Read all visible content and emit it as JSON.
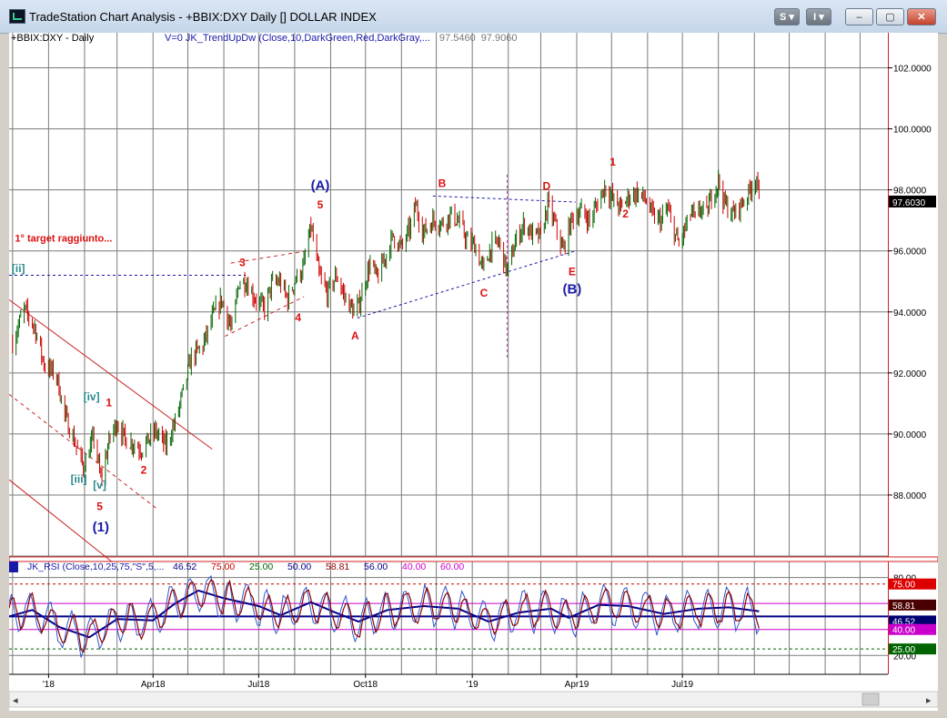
{
  "window": {
    "title": "TradeStation Chart Analysis - +BBIX:DXY Daily [] DOLLAR INDEX",
    "buttons": {
      "s": "S ▾",
      "i": "I ▾",
      "minimize": "‒",
      "maximize": "▢",
      "close": "✕"
    }
  },
  "colors": {
    "bull": "#006400",
    "bear": "#cc0000",
    "wave_red": "#dd1111",
    "wave_blue": "#1a1aaa",
    "wave_teal": "#2a8a8a",
    "rsi_fast": "#8b0000",
    "rsi_slow": "#00008b"
  },
  "chart_data": [
    {
      "type": "candlestick",
      "symbol_label": "+BBIX:DXY - Daily",
      "indicator_label": "V=0  JK_TrendUpDw  (Close,10,DarkGreen,Red,DarkGray,...",
      "indicator_values": [
        "97.5460",
        "97.9060"
      ],
      "last_price": "97.6030",
      "ylim": [
        86,
        103
      ],
      "y_ticks": [
        "88.0000",
        "90.0000",
        "92.0000",
        "94.0000",
        "96.0000",
        "98.0000",
        "100.0000",
        "102.0000"
      ],
      "x_ticks": [
        "'18",
        "Apr18",
        "Jul18",
        "Oct18",
        "'19",
        "Apr19",
        "Jul19"
      ],
      "x_tick_dates": [
        "2018-01-01",
        "2018-04-01",
        "2018-07-01",
        "2018-10-01",
        "2019-01-01",
        "2019-04-01",
        "2019-07-01"
      ],
      "x_range": [
        "2017-11-28",
        "2019-12-25"
      ],
      "grid": true,
      "price_path": [
        [
          "2017-12-01",
          93.0
        ],
        [
          "2017-12-11",
          94.1
        ],
        [
          "2017-12-20",
          93.5
        ],
        [
          "2017-12-28",
          92.3
        ],
        [
          "2018-01-08",
          91.9
        ],
        [
          "2018-01-15",
          90.6
        ],
        [
          "2018-01-22",
          89.9
        ],
        [
          "2018-01-31",
          88.9
        ],
        [
          "2018-02-09",
          89.9
        ],
        [
          "2018-02-15",
          88.5
        ],
        [
          "2018-02-23",
          89.9
        ],
        [
          "2018-03-01",
          90.4
        ],
        [
          "2018-03-08",
          89.8
        ],
        [
          "2018-03-15",
          89.7
        ],
        [
          "2018-03-22",
          89.5
        ],
        [
          "2018-04-03",
          90.1
        ],
        [
          "2018-04-12",
          89.6
        ],
        [
          "2018-04-20",
          90.4
        ],
        [
          "2018-04-27",
          91.4
        ],
        [
          "2018-05-04",
          92.5
        ],
        [
          "2018-05-14",
          92.9
        ],
        [
          "2018-05-22",
          93.8
        ],
        [
          "2018-05-30",
          94.4
        ],
        [
          "2018-06-08",
          93.4
        ],
        [
          "2018-06-14",
          95.0
        ],
        [
          "2018-06-20",
          95.0
        ],
        [
          "2018-06-27",
          94.5
        ],
        [
          "2018-07-06",
          94.1
        ],
        [
          "2018-07-12",
          94.9
        ],
        [
          "2018-07-19",
          95.0
        ],
        [
          "2018-07-26",
          94.4
        ],
        [
          "2018-08-02",
          95.1
        ],
        [
          "2018-08-08",
          95.4
        ],
        [
          "2018-08-15",
          96.8
        ],
        [
          "2018-08-22",
          95.2
        ],
        [
          "2018-08-29",
          94.6
        ],
        [
          "2018-09-06",
          95.2
        ],
        [
          "2018-09-13",
          94.5
        ],
        [
          "2018-09-21",
          94.0
        ],
        [
          "2018-09-25",
          94.2
        ],
        [
          "2018-10-05",
          95.6
        ],
        [
          "2018-10-11",
          95.1
        ],
        [
          "2018-10-18",
          95.8
        ],
        [
          "2018-10-25",
          96.5
        ],
        [
          "2018-11-01",
          96.1
        ],
        [
          "2018-11-09",
          96.8
        ],
        [
          "2018-11-13",
          97.5
        ],
        [
          "2018-11-20",
          96.6
        ],
        [
          "2018-11-28",
          97.0
        ],
        [
          "2018-12-06",
          96.9
        ],
        [
          "2018-12-14",
          97.2
        ],
        [
          "2018-12-21",
          96.9
        ],
        [
          "2018-12-28",
          96.3
        ],
        [
          "2019-01-03",
          96.2
        ],
        [
          "2019-01-10",
          95.4
        ],
        [
          "2019-01-17",
          96.1
        ],
        [
          "2019-01-24",
          96.3
        ],
        [
          "2019-01-31",
          95.3
        ],
        [
          "2019-02-08",
          96.4
        ],
        [
          "2019-02-15",
          96.9
        ],
        [
          "2019-02-22",
          96.5
        ],
        [
          "2019-03-01",
          96.5
        ],
        [
          "2019-03-07",
          97.5
        ],
        [
          "2019-03-14",
          96.8
        ],
        [
          "2019-03-20",
          96.0
        ],
        [
          "2019-03-28",
          97.1
        ],
        [
          "2019-04-05",
          97.3
        ],
        [
          "2019-04-12",
          97.0
        ],
        [
          "2019-04-17",
          97.4
        ],
        [
          "2019-04-25",
          98.1
        ],
        [
          "2019-05-02",
          97.7
        ],
        [
          "2019-05-09",
          97.4
        ],
        [
          "2019-05-16",
          97.8
        ],
        [
          "2019-05-23",
          97.9
        ],
        [
          "2019-05-30",
          97.7
        ],
        [
          "2019-06-06",
          97.1
        ],
        [
          "2019-06-13",
          97.0
        ],
        [
          "2019-06-18",
          97.4
        ],
        [
          "2019-06-24",
          96.6
        ],
        [
          "2019-06-28",
          96.2
        ],
        [
          "2019-07-03",
          96.7
        ],
        [
          "2019-07-09",
          97.3
        ],
        [
          "2019-07-12",
          97.0
        ],
        [
          "2019-07-17",
          97.4
        ],
        [
          "2019-07-22",
          97.2
        ],
        [
          "2019-07-25",
          97.7
        ],
        [
          "2019-07-31",
          98.2
        ],
        [
          "2019-08-01",
          98.3
        ],
        [
          "2019-08-06",
          97.6
        ],
        [
          "2019-08-09",
          97.4
        ],
        [
          "2019-08-14",
          97.2
        ],
        [
          "2019-08-20",
          97.5
        ],
        [
          "2019-08-27",
          97.9
        ],
        [
          "2019-08-30",
          98.2
        ],
        [
          "2019-09-03",
          98.4
        ],
        [
          "2019-09-05",
          97.6
        ]
      ],
      "wave_labels": [
        {
          "text": "[ii]",
          "date": "2017-12-06",
          "price": 95.3,
          "color": "teal"
        },
        {
          "text": "[iii]",
          "date": "2018-01-27",
          "price": 88.4,
          "color": "teal"
        },
        {
          "text": "[iv]",
          "date": "2018-02-07",
          "price": 91.1,
          "color": "teal"
        },
        {
          "text": "[v]",
          "date": "2018-02-14",
          "price": 88.2,
          "color": "teal"
        },
        {
          "text": "1",
          "date": "2018-02-22",
          "price": 90.9,
          "color": "red"
        },
        {
          "text": "5",
          "date": "2018-02-14",
          "price": 87.5,
          "color": "red"
        },
        {
          "text": "(1)",
          "date": "2018-02-15",
          "price": 86.8,
          "color": "blue"
        },
        {
          "text": "2",
          "date": "2018-03-24",
          "price": 88.7,
          "color": "red"
        },
        {
          "text": "3",
          "date": "2018-06-17",
          "price": 95.5,
          "color": "red"
        },
        {
          "text": "4",
          "date": "2018-08-04",
          "price": 93.7,
          "color": "red"
        },
        {
          "text": "5",
          "date": "2018-08-23",
          "price": 97.4,
          "color": "red"
        },
        {
          "text": "(A)",
          "date": "2018-08-23",
          "price": 98.0,
          "color": "blue"
        },
        {
          "text": "A",
          "date": "2018-09-22",
          "price": 93.1,
          "color": "red"
        },
        {
          "text": "B",
          "date": "2018-12-06",
          "price": 98.1,
          "color": "red"
        },
        {
          "text": "C",
          "date": "2019-01-11",
          "price": 94.5,
          "color": "red"
        },
        {
          "text": "D",
          "date": "2019-03-06",
          "price": 98.0,
          "color": "red"
        },
        {
          "text": "E",
          "date": "2019-03-28",
          "price": 95.2,
          "color": "red"
        },
        {
          "text": "(B)",
          "date": "2019-03-28",
          "price": 94.6,
          "color": "blue"
        },
        {
          "text": "1",
          "date": "2019-05-02",
          "price": 98.8,
          "color": "red"
        },
        {
          "text": "2",
          "date": "2019-05-13",
          "price": 97.1,
          "color": "red"
        }
      ],
      "annotation": {
        "text": "1° target raggiunto...",
        "date": "2017-12-03",
        "price": 96.3
      },
      "target_line": {
        "price": 95.2,
        "from": "2017-11-28",
        "to": "2018-06-20"
      },
      "trendlines": [
        {
          "style": "solid",
          "from": [
            "2017-11-28",
            94.4
          ],
          "to": [
            "2018-05-22",
            89.5
          ]
        },
        {
          "style": "solid",
          "from": [
            "2017-11-28",
            88.5
          ],
          "to": [
            "2018-02-25",
            85.8
          ]
        },
        {
          "style": "dashed_red",
          "from": [
            "2017-11-28",
            91.3
          ],
          "to": [
            "2018-04-06",
            87.5
          ]
        },
        {
          "style": "dashed_blue",
          "from": [
            "2018-09-24",
            93.8
          ],
          "to": [
            "2019-03-31",
            96.0
          ]
        },
        {
          "style": "dashed_blue",
          "from": [
            "2018-11-28",
            97.8
          ],
          "to": [
            "2019-03-31",
            97.6
          ]
        },
        {
          "style": "dashed_red",
          "from": [
            "2018-06-02",
            93.2
          ],
          "to": [
            "2018-08-09",
            94.5
          ]
        },
        {
          "style": "dashed_red",
          "from": [
            "2018-06-07",
            95.6
          ],
          "to": [
            "2018-08-12",
            96.0
          ]
        }
      ],
      "vertical_marker": {
        "date": "2019-01-31",
        "from_price": 98.5,
        "to_price": 92.5
      }
    },
    {
      "type": "line",
      "indicator_label": "JK_RSI (Close,10,25,75,\"S\",5,...",
      "legend_values": [
        {
          "text": "46.52",
          "color": "#00008b"
        },
        {
          "text": "75.00",
          "color": "#cc0000"
        },
        {
          "text": "25.00",
          "color": "#006400"
        },
        {
          "text": "50.00",
          "color": "#00008b"
        },
        {
          "text": "58.81",
          "color": "#8b0000"
        },
        {
          "text": "56.00",
          "color": "#00008b"
        },
        {
          "text": "40.00",
          "color": "#cc00cc"
        },
        {
          "text": "60.00",
          "color": "#cc00cc"
        }
      ],
      "ylim": [
        16,
        86
      ],
      "y_ticks": [
        "80.00",
        "20.00"
      ],
      "levels": [
        {
          "value": 75,
          "color": "#cc0000",
          "dashed": true
        },
        {
          "value": 60,
          "color": "#cc00cc",
          "dashed": false
        },
        {
          "value": 50,
          "color": "#00008b",
          "dashed": false
        },
        {
          "value": 40,
          "color": "#cc00cc",
          "dashed": false
        },
        {
          "value": 25,
          "color": "#006400",
          "dashed": true
        }
      ],
      "value_tags": [
        {
          "text": "75.00",
          "value": 75,
          "bg": "#dd0000",
          "fg": "#ffffff"
        },
        {
          "text": "58.81",
          "value": 58.81,
          "bg": "#4a0000",
          "fg": "#ffffff"
        },
        {
          "text": "46.52",
          "value": 46.52,
          "bg": "#000070",
          "fg": "#ffffff"
        },
        {
          "text": "40.00",
          "value": 40,
          "bg": "#cc00cc",
          "fg": "#ffffff"
        },
        {
          "text": "25.00",
          "value": 25,
          "bg": "#006400",
          "fg": "#ffffff"
        }
      ],
      "slow_path": [
        [
          "2017-11-28",
          50
        ],
        [
          "2017-12-18",
          55
        ],
        [
          "2018-01-10",
          42
        ],
        [
          "2018-02-05",
          34
        ],
        [
          "2018-03-01",
          48
        ],
        [
          "2018-04-01",
          47
        ],
        [
          "2018-04-20",
          60
        ],
        [
          "2018-05-10",
          70
        ],
        [
          "2018-06-01",
          64
        ],
        [
          "2018-07-01",
          58
        ],
        [
          "2018-07-20",
          51
        ],
        [
          "2018-08-15",
          61
        ],
        [
          "2018-09-05",
          53
        ],
        [
          "2018-09-25",
          46
        ],
        [
          "2018-10-20",
          55
        ],
        [
          "2018-11-20",
          58
        ],
        [
          "2018-12-20",
          56
        ],
        [
          "2019-01-15",
          46
        ],
        [
          "2019-02-10",
          53
        ],
        [
          "2019-03-10",
          56
        ],
        [
          "2019-03-25",
          49
        ],
        [
          "2019-04-20",
          59
        ],
        [
          "2019-05-15",
          58
        ],
        [
          "2019-06-15",
          52
        ],
        [
          "2019-07-15",
          56
        ],
        [
          "2019-08-10",
          57
        ],
        [
          "2019-09-05",
          54
        ]
      ]
    }
  ]
}
